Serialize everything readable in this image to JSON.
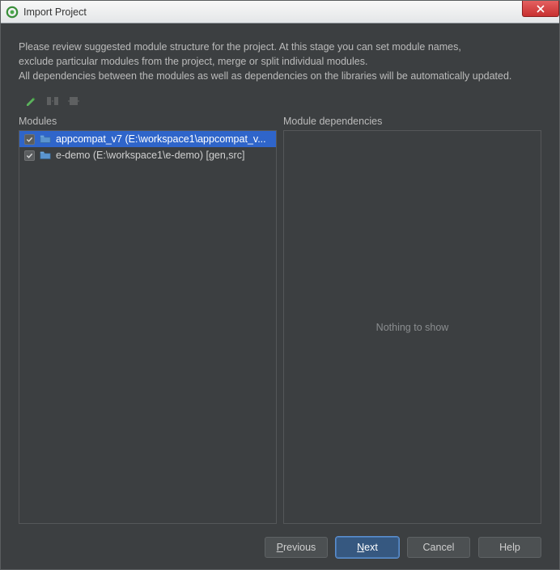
{
  "window": {
    "title": "Import Project"
  },
  "description": {
    "line1": "Please review suggested module structure for the project. At this stage you can set module names,",
    "line2": "exclude particular modules from the project, merge or split individual modules.",
    "line3": "All dependencies between the modules as well as dependencies on the libraries will be automatically updated."
  },
  "panels": {
    "modules_title": "Modules",
    "dependencies_title": "Module dependencies",
    "dependencies_empty": "Nothing to show"
  },
  "modules": [
    {
      "name": "appcompat_v7",
      "path": "(E:\\workspace1\\appcompat_v...",
      "checked": true,
      "selected": true
    },
    {
      "name": "e-demo",
      "path": "(E:\\workspace1\\e-demo) [gen,src]",
      "checked": true,
      "selected": false
    }
  ],
  "buttons": {
    "previous": "Previous",
    "next": "Next",
    "cancel": "Cancel",
    "help": "Help"
  }
}
